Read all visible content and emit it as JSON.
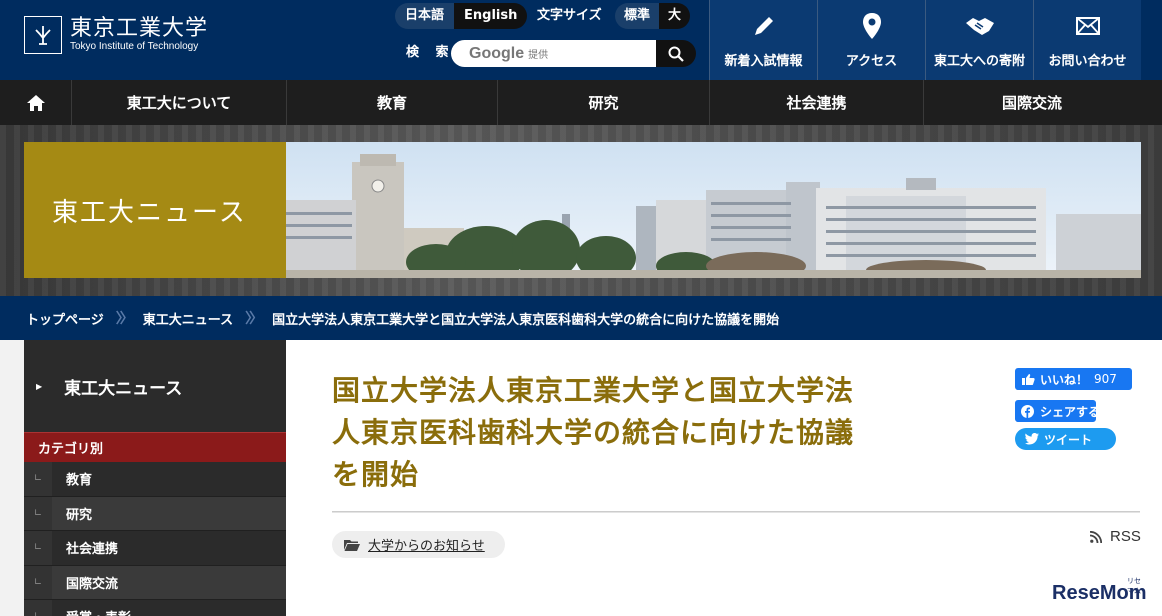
{
  "header": {
    "logo_ja": "東京工業大学",
    "logo_en": "Tokyo Institute of Technology",
    "lang": [
      {
        "label": "日本語",
        "active": false
      },
      {
        "label": "English",
        "active": true
      }
    ],
    "fontsize_label": "文字サイズ",
    "sizes": [
      {
        "label": "標準",
        "active": false
      },
      {
        "label": "大",
        "active": true
      }
    ],
    "search_label": "検 索",
    "search_brand": "Google",
    "search_brand_sub": "提供",
    "quick_links": [
      {
        "label": "新着入試情報",
        "icon": "pencil-icon"
      },
      {
        "label": "アクセス",
        "icon": "map-pin-icon"
      },
      {
        "label": "東工大への寄附",
        "icon": "handshake-icon"
      },
      {
        "label": "お問い合わせ",
        "icon": "mail-icon"
      }
    ]
  },
  "gnav": {
    "items": [
      "東工大について",
      "教育",
      "研究",
      "社会連携",
      "国際交流"
    ]
  },
  "banner": {
    "title": "東工大ニュース"
  },
  "breadcrumb": {
    "items": [
      "トップページ",
      "東工大ニュース",
      "国立大学法人東京工業大学と国立大学法人東京医科歯科大学の統合に向けた協議を開始"
    ]
  },
  "sidebar": {
    "heading": "東工大ニュース",
    "category_label": "カテゴリ別",
    "items": [
      "教育",
      "研究",
      "社会連携",
      "国際交流",
      "受賞・表彰"
    ]
  },
  "article": {
    "title_lines": [
      "国立大学法人東京工業大学と国立大学法",
      "人東京医科歯科大学の統合に向けた協議",
      "を開始"
    ],
    "category_tag": "大学からのお知らせ",
    "rss_label": "RSS"
  },
  "social": {
    "like_label": "いいね！",
    "like_count": "907",
    "share_label": "シェアする",
    "tweet_label": "ツイート"
  },
  "colors": {
    "navy": "#002c5f",
    "gold": "#a58a14",
    "title_gold": "#8a6d0b",
    "category_red": "#8b1a1a"
  },
  "watermark": {
    "text": "ReseMom",
    "small": "リセマム"
  }
}
